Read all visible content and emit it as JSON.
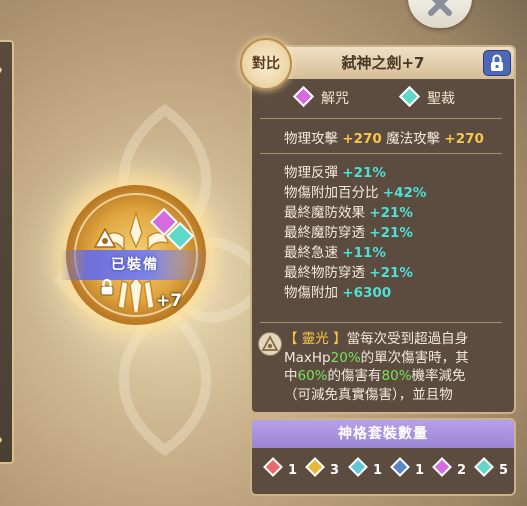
{
  "item": {
    "name": "弑神之劍+7",
    "compare_label": "對比",
    "equipped_label": "已裝備",
    "level_label": "+7"
  },
  "tags": [
    {
      "label": "解咒",
      "color": "#d66be0"
    },
    {
      "label": "聖裁",
      "color": "#5fd8c8"
    }
  ],
  "base_stats": {
    "physical_attack_label": "物理攻擊",
    "physical_attack_value": "+270",
    "magic_attack_label": "魔法攻擊",
    "magic_attack_value": "+270"
  },
  "bonus_stats": [
    {
      "label": "物理反彈",
      "value": "+21%"
    },
    {
      "label": "物傷附加百分比",
      "value": "+42%"
    },
    {
      "label": "最終魔防效果",
      "value": "+21%"
    },
    {
      "label": "最終魔防穿透",
      "value": "+21%"
    },
    {
      "label": "最終急速",
      "value": "+11%"
    },
    {
      "label": "最終物防穿透",
      "value": "+21%"
    },
    {
      "label": "物傷附加",
      "value": "+6300"
    }
  ],
  "skill": {
    "name": "【 靈光 】",
    "line1_rest": "當每次受到超過自身",
    "line2_a": "MaxHp",
    "line2_pct": "20%",
    "line2_b": "的單次傷害時，其",
    "line3_a": "中",
    "line3_pct1": "60%",
    "line3_b": "的傷害有",
    "line3_pct2": "80%",
    "line3_c": "機率減免",
    "line4": "（可減免真實傷害），並且物"
  },
  "set_panel": {
    "title": "神格套裝數量",
    "items": [
      {
        "color": "#e86a6a",
        "count": "1"
      },
      {
        "color": "#e9b53a",
        "count": "3"
      },
      {
        "color": "#5fc8d6",
        "count": "1"
      },
      {
        "color": "#5a86c6",
        "count": "1"
      },
      {
        "color": "#d66be0",
        "count": "2"
      },
      {
        "color": "#5fd8c8",
        "count": "5"
      }
    ]
  },
  "colors": {
    "panel_bg": "#5b4c3f",
    "accent_orange": "#f6c54a",
    "accent_cyan": "#4fe0d4",
    "accent_green": "#7be05b",
    "set_header": "#a893df"
  }
}
